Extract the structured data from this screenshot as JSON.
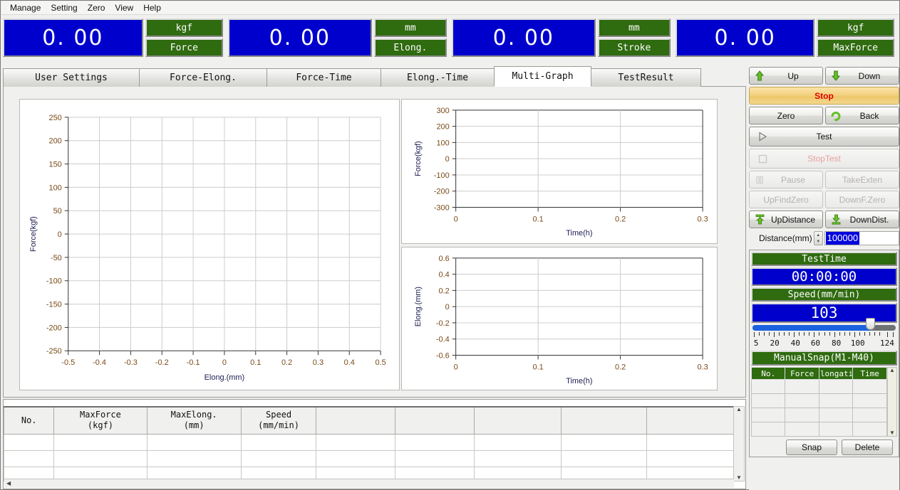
{
  "menubar": {
    "items": [
      "Manage",
      "Setting",
      "Zero",
      "View",
      "Help"
    ]
  },
  "readouts": [
    {
      "value": "0. 00",
      "unit": "kgf",
      "name": "Force"
    },
    {
      "value": "0. 00",
      "unit": "mm",
      "name": "Elong."
    },
    {
      "value": "0. 00",
      "unit": "mm",
      "name": "Stroke"
    },
    {
      "value": "0. 00",
      "unit": "kgf",
      "name": "MaxForce"
    }
  ],
  "tabs": [
    {
      "label": "User Settings",
      "active": false
    },
    {
      "label": "Force-Elong.",
      "active": false
    },
    {
      "label": "Force-Time",
      "active": false
    },
    {
      "label": "Elong.-Time",
      "active": false
    },
    {
      "label": "Multi-Graph",
      "active": true
    },
    {
      "label": "TestResult",
      "active": false
    }
  ],
  "chart_data": [
    {
      "id": "force-elong",
      "type": "line",
      "title": "",
      "xlabel": "Elong.(mm)",
      "ylabel": "Force(kgf)",
      "xlim": [
        -0.5,
        0.5
      ],
      "ylim": [
        -250,
        250
      ],
      "xticks": [
        "-0.5",
        "-0.4",
        "-0.3",
        "-0.2",
        "-0.1",
        "0",
        "0.1",
        "0.2",
        "0.3",
        "0.4",
        "0.5"
      ],
      "yticks": [
        "250",
        "200",
        "150",
        "100",
        "50",
        "0",
        "-50",
        "-100",
        "-150",
        "-200",
        "-250"
      ],
      "grid": true,
      "legend": "none",
      "series": [
        {
          "name": "Force-Elong.",
          "x": [],
          "y": []
        }
      ]
    },
    {
      "id": "force-time",
      "type": "line",
      "title": "",
      "xlabel": "Time(h)",
      "ylabel": "Force(kgf)",
      "xlim": [
        0,
        0.3
      ],
      "ylim": [
        -300,
        300
      ],
      "xticks": [
        "0",
        "0.1",
        "0.2",
        "0.3"
      ],
      "yticks": [
        "300",
        "200",
        "100",
        "0",
        "-100",
        "-200",
        "-300"
      ],
      "grid": true,
      "legend": "none",
      "series": [
        {
          "name": "Force-Time",
          "x": [],
          "y": []
        }
      ]
    },
    {
      "id": "elong-time",
      "type": "line",
      "title": "",
      "xlabel": "Time(h)",
      "ylabel": "Elong.(mm)",
      "xlim": [
        0,
        0.3
      ],
      "ylim": [
        -0.6,
        0.6
      ],
      "xticks": [
        "0",
        "0.1",
        "0.2",
        "0.3"
      ],
      "yticks": [
        "0.6",
        "0.4",
        "0.2",
        "0",
        "-0.2",
        "-0.4",
        "-0.6"
      ],
      "grid": true,
      "legend": "none",
      "series": [
        {
          "name": "Elong.-Time",
          "x": [],
          "y": []
        }
      ]
    }
  ],
  "result_table": {
    "headers": [
      "No.",
      "MaxForce\n(kgf)",
      "MaxElong.\n(mm)",
      "Speed\n(mm/min)",
      "",
      "",
      "",
      "",
      ""
    ],
    "header_lines": [
      [
        "No.",
        ""
      ],
      [
        "MaxForce",
        "(kgf)"
      ],
      [
        "MaxElong.",
        "(mm)"
      ],
      [
        "Speed",
        "(mm/min)"
      ],
      [
        "",
        ""
      ],
      [
        "",
        ""
      ],
      [
        "",
        ""
      ],
      [
        "",
        ""
      ],
      [
        "",
        ""
      ]
    ],
    "rows": [
      [
        "",
        "",
        "",
        "",
        "",
        "",
        "",
        "",
        ""
      ],
      [
        "",
        "",
        "",
        "",
        "",
        "",
        "",
        "",
        ""
      ],
      [
        "",
        "",
        "",
        "",
        "",
        "",
        "",
        "",
        ""
      ]
    ]
  },
  "sidebar": {
    "buttons": {
      "up": "Up",
      "down": "Down",
      "stop": "Stop",
      "zero": "Zero",
      "back": "Back",
      "test": "Test",
      "stoptest": "StopTest",
      "pause": "Pause",
      "takeexten": "TakeExten",
      "upfindzero": "UpFindZero",
      "downfzero": "DownF.Zero",
      "updistance": "UpDistance",
      "downdist": "DownDist."
    },
    "distance": {
      "label": "Distance(mm)",
      "value": "100000"
    },
    "testtime": {
      "label": "TestTime",
      "value": "00:00:00"
    },
    "speed": {
      "label": "Speed(mm/min)",
      "value": "103",
      "min": 5,
      "max": 124,
      "tick_labels": [
        "5",
        "20",
        "40",
        "60",
        "80",
        "100",
        "124"
      ]
    },
    "manual_snap": {
      "title": "ManualSnap(M1-M40)",
      "headers": [
        "No.",
        "Force",
        "longatio",
        "Time"
      ],
      "rows": [
        [
          "",
          "",
          "",
          ""
        ],
        [
          "",
          "",
          "",
          ""
        ],
        [
          "",
          "",
          "",
          ""
        ],
        [
          "",
          "",
          "",
          ""
        ]
      ],
      "snap_button": "Snap",
      "delete_button": "Delete"
    }
  },
  "colors": {
    "readout_value_bg": "#0000cc",
    "readout_label_bg": "#2f6b0f",
    "stop_text": "#e00000",
    "slider_fill": "#1b62e0",
    "axis_tick_text": "#7a4a16",
    "axis_title_text": "#1c1c52"
  }
}
